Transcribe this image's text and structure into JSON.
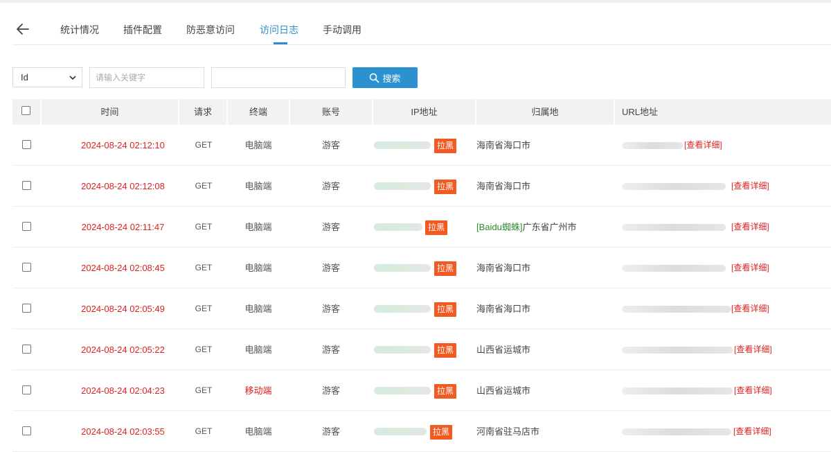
{
  "tabs": [
    {
      "label": "统计情况"
    },
    {
      "label": "插件配置"
    },
    {
      "label": "防恶意访问"
    },
    {
      "label": "访问日志"
    },
    {
      "label": "手动调用"
    }
  ],
  "filter": {
    "select_value": "Id",
    "keyword_placeholder": "请输入关键字",
    "search_label": "搜索"
  },
  "columns": {
    "time": "时间",
    "method": "请求",
    "terminal": "终端",
    "account": "账号",
    "ip": "IP地址",
    "location": "归属地",
    "url": "URL地址"
  },
  "blacklist_label": "拉黑",
  "detail_label": "[查看详细]",
  "rows": [
    {
      "time": "2024-08-24 02:12:10",
      "method": "GET",
      "terminal": "电脑端",
      "account": "游客",
      "location": "海南省海口市",
      "spider": ""
    },
    {
      "time": "2024-08-24 02:12:08",
      "method": "GET",
      "terminal": "电脑端",
      "account": "游客",
      "location": "海南省海口市",
      "spider": ""
    },
    {
      "time": "2024-08-24 02:11:47",
      "method": "GET",
      "terminal": "电脑端",
      "account": "游客",
      "location": "广东省广州市",
      "spider": "[Baidu蜘蛛]"
    },
    {
      "time": "2024-08-24 02:08:45",
      "method": "GET",
      "terminal": "电脑端",
      "account": "游客",
      "location": "海南省海口市",
      "spider": ""
    },
    {
      "time": "2024-08-24 02:05:49",
      "method": "GET",
      "terminal": "电脑端",
      "account": "游客",
      "location": "海南省海口市",
      "spider": ""
    },
    {
      "time": "2024-08-24 02:05:22",
      "method": "GET",
      "terminal": "电脑端",
      "account": "游客",
      "location": "山西省运城市",
      "spider": ""
    },
    {
      "time": "2024-08-24 02:04:23",
      "method": "GET",
      "terminal": "移动端",
      "account": "游客",
      "location": "山西省运城市",
      "spider": ""
    },
    {
      "time": "2024-08-24 02:03:55",
      "method": "GET",
      "terminal": "电脑端",
      "account": "游客",
      "location": "河南省驻马店市",
      "spider": ""
    }
  ]
}
